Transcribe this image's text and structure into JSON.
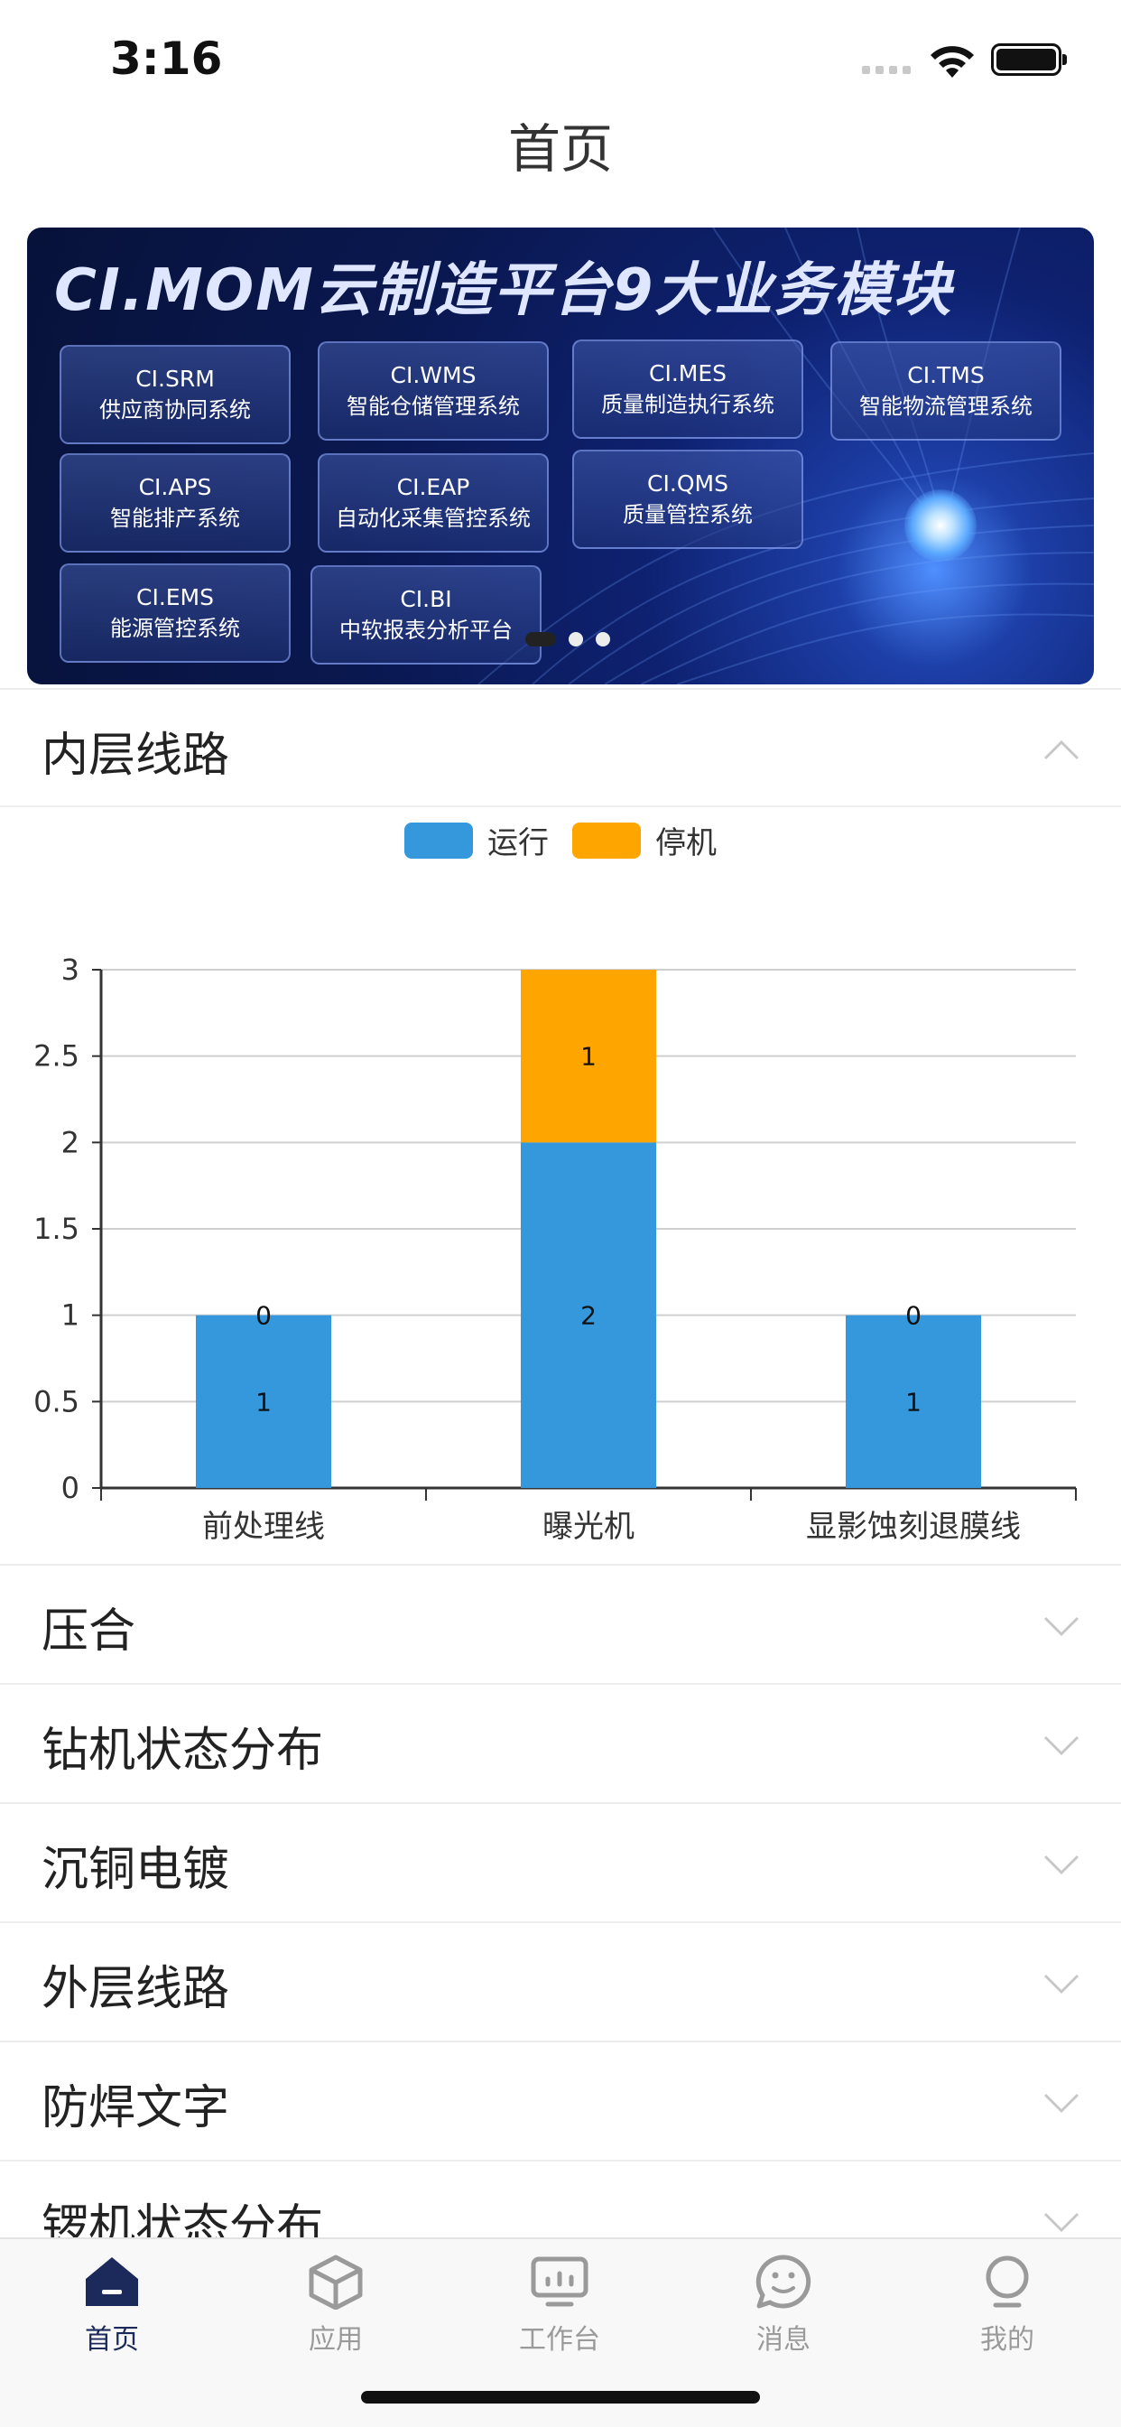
{
  "status_bar": {
    "time": "3:16"
  },
  "header": {
    "title": "首页"
  },
  "banner": {
    "title": "CI.MOM云制造平台9大业务模块",
    "modules": [
      {
        "code": "CI.SRM",
        "desc": "供应商协同系统"
      },
      {
        "code": "CI.WMS",
        "desc": "智能仓储管理系统"
      },
      {
        "code": "CI.MES",
        "desc": "质量制造执行系统"
      },
      {
        "code": "CI.TMS",
        "desc": "智能物流管理系统"
      },
      {
        "code": "CI.APS",
        "desc": "智能排产系统"
      },
      {
        "code": "CI.EAP",
        "desc": "自动化采集管控系统"
      },
      {
        "code": "CI.QMS",
        "desc": "质量管控系统"
      },
      {
        "code": "CI.EMS",
        "desc": "能源管控系统"
      },
      {
        "code": "CI.BI",
        "desc": "中软报表分析平台"
      }
    ],
    "page_count": 3,
    "active_page": 1
  },
  "sections": [
    {
      "label": "内层线路",
      "expanded": true
    },
    {
      "label": "压合",
      "expanded": false
    },
    {
      "label": "钻机状态分布",
      "expanded": false
    },
    {
      "label": "沉铜电镀",
      "expanded": false
    },
    {
      "label": "外层线路",
      "expanded": false
    },
    {
      "label": "防焊文字",
      "expanded": false
    },
    {
      "label": "锣机状态分布",
      "expanded": false
    }
  ],
  "chart_data": {
    "type": "bar",
    "stacked": true,
    "categories": [
      "前处理线",
      "曝光机",
      "显影蚀刻退膜线"
    ],
    "series": [
      {
        "name": "运行",
        "values": [
          1,
          2,
          1
        ],
        "color": "#3598dc"
      },
      {
        "name": "停机",
        "values": [
          0,
          1,
          0
        ],
        "color": "#ffa500"
      }
    ],
    "ylim": [
      0,
      3
    ],
    "yticks": [
      "0",
      "0.5",
      "1",
      "1.5",
      "2",
      "2.5",
      "3"
    ],
    "grid": true,
    "legend": "top-center",
    "title": "",
    "xlabel": "",
    "ylabel": ""
  },
  "tabbar": {
    "items": [
      {
        "label": "首页",
        "icon": "home-icon",
        "active": true
      },
      {
        "label": "应用",
        "icon": "cube-icon",
        "active": false
      },
      {
        "label": "工作台",
        "icon": "monitor-icon",
        "active": false
      },
      {
        "label": "消息",
        "icon": "chat-icon",
        "active": false
      },
      {
        "label": "我的",
        "icon": "profile-icon",
        "active": false
      }
    ]
  },
  "colors": {
    "accent": "#1b2a5a",
    "run": "#3598dc",
    "stop": "#ffa500"
  }
}
